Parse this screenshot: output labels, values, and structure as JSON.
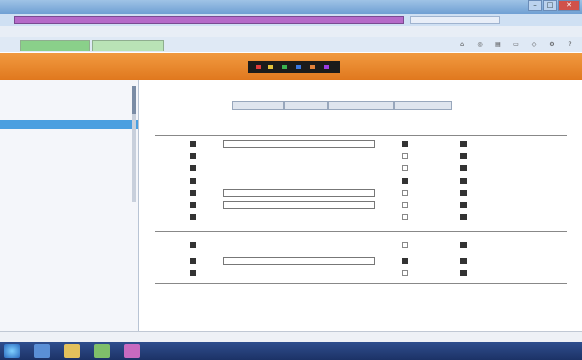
{
  "window": {
    "title": "",
    "buttons": {
      "minimize": "–",
      "maximize": "□",
      "close": "✕"
    }
  },
  "address": {
    "url": ""
  },
  "menu": {
    "items": [
      "",
      "",
      "",
      "",
      ""
    ]
  },
  "tabs": [
    {
      "label": ""
    },
    {
      "label": ""
    }
  ],
  "toolbar_icons": [
    "home-icon",
    "rss-icon",
    "print-icon",
    "page-icon",
    "safety-icon",
    "tools-icon",
    "help-icon"
  ],
  "header": {
    "brand_line1": "",
    "brand_line2": "",
    "user_link": ""
  },
  "sidebar": {
    "items": [
      {
        "label": "",
        "selected": false
      },
      {
        "label": "",
        "selected": false
      },
      {
        "label": "",
        "selected": false
      },
      {
        "label": "",
        "selected": false
      },
      {
        "label": "",
        "selected": true
      },
      {
        "label": "",
        "selected": false
      },
      {
        "label": "",
        "selected": false
      },
      {
        "label": "",
        "selected": false
      },
      {
        "label": "",
        "selected": false
      },
      {
        "label": "",
        "selected": false
      }
    ],
    "sections": [
      {
        "title": "",
        "lines": [
          "",
          ""
        ]
      },
      {
        "title": "",
        "lines": [
          "",
          ""
        ]
      },
      {
        "title": "",
        "lines": [
          ""
        ]
      }
    ],
    "footer": ""
  },
  "main": {
    "page_title": "",
    "toolbar": [
      "",
      "",
      "",
      ""
    ],
    "columns": [
      "",
      "",
      "",
      "",
      ""
    ],
    "rows": [
      {
        "name": "",
        "editable": true,
        "col1_checked": true,
        "col2_checked": true,
        "extra": ""
      },
      {
        "name": "",
        "editable": false,
        "col1_checked": false,
        "col2_checked": true,
        "extra": ""
      },
      {
        "name": "",
        "editable": false,
        "col1_checked": false,
        "col2_checked": true,
        "extra": ""
      },
      {
        "name": "",
        "editable": false,
        "col1_checked": true,
        "col2_checked": true,
        "extra": ""
      },
      {
        "name": "",
        "editable": true,
        "col1_checked": false,
        "col2_checked": true,
        "extra": ""
      },
      {
        "name": "",
        "editable": true,
        "col1_checked": false,
        "col2_checked": true,
        "extra": ""
      },
      {
        "name": "",
        "editable": false,
        "col1_checked": false,
        "col2_checked": true,
        "extra": ""
      },
      {
        "name": "",
        "editable": false,
        "col1_checked": false,
        "col2_checked": true,
        "extra": ""
      },
      {
        "name": "",
        "editable": true,
        "col1_checked": true,
        "col2_checked": true,
        "extra": ""
      },
      {
        "name": "",
        "editable": false,
        "col1_checked": false,
        "col2_checked": true,
        "extra": ""
      }
    ]
  },
  "statusbar": {
    "left": "",
    "middle": "",
    "right": ""
  },
  "taskbar": {
    "clock": ""
  },
  "colors": {
    "header_orange": "#e98a2f",
    "selected_blue": "#4a9fe0",
    "tab_green": "#8ad08a",
    "address_purple": "#b56ac8",
    "taskbar_blue": "#253f7a"
  }
}
